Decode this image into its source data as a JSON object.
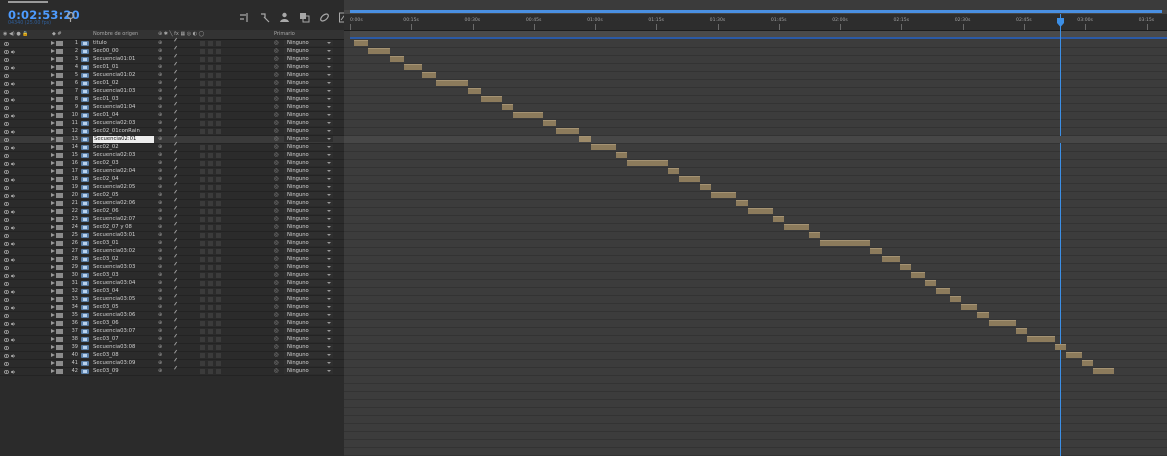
{
  "header": {
    "timecode": "0:02:53:20",
    "fps": "04340 (25.00 fps)",
    "search_placeholder": "ρ."
  },
  "columns": {
    "av": "◉ ◀) ● 🔒",
    "label": "◆ #",
    "source_name": "Nombre de origen",
    "switches": "⊕ ✱ ╲ fx ▦ ◎ ◐ ◯",
    "parent": "Primario"
  },
  "parent_default": "Ninguno",
  "layers": [
    {
      "num": "1",
      "name": "titulo",
      "audio": false
    },
    {
      "num": "2",
      "name": "Sec00_00",
      "audio": true
    },
    {
      "num": "3",
      "name": "Secuencia01:01",
      "audio": false
    },
    {
      "num": "4",
      "name": "Sec01_01",
      "audio": true
    },
    {
      "num": "5",
      "name": "Secuencia01:02",
      "audio": false
    },
    {
      "num": "6",
      "name": "Sec01_02",
      "audio": true
    },
    {
      "num": "7",
      "name": "Secuencia01:03",
      "audio": false
    },
    {
      "num": "8",
      "name": "Sec01_03",
      "audio": true
    },
    {
      "num": "9",
      "name": "Secuencia01:04",
      "audio": false
    },
    {
      "num": "10",
      "name": "Sec01_04",
      "audio": true
    },
    {
      "num": "11",
      "name": "Secuencia02:03",
      "audio": false
    },
    {
      "num": "12",
      "name": "Sec02_01conRain",
      "audio": true
    },
    {
      "num": "13",
      "name": "Secuencia02:01",
      "audio": false,
      "selected": true
    },
    {
      "num": "14",
      "name": "Sec02_02",
      "audio": true
    },
    {
      "num": "15",
      "name": "Secuencia02:03",
      "audio": false
    },
    {
      "num": "16",
      "name": "Sec02_03",
      "audio": true
    },
    {
      "num": "17",
      "name": "Secuencia02:04",
      "audio": false
    },
    {
      "num": "18",
      "name": "Sec02_04",
      "audio": true
    },
    {
      "num": "19",
      "name": "Secuencia02:05",
      "audio": false
    },
    {
      "num": "20",
      "name": "Sec02_05",
      "audio": true
    },
    {
      "num": "21",
      "name": "Secuencia02:06",
      "audio": false
    },
    {
      "num": "22",
      "name": "Sec02_06",
      "audio": true
    },
    {
      "num": "23",
      "name": "Secuencia02:07",
      "audio": false
    },
    {
      "num": "24",
      "name": "Sec02_07 y 08",
      "audio": true
    },
    {
      "num": "25",
      "name": "Secuencia03:01",
      "audio": false
    },
    {
      "num": "26",
      "name": "Sec03_01",
      "audio": true
    },
    {
      "num": "27",
      "name": "Secuencia03:02",
      "audio": false
    },
    {
      "num": "28",
      "name": "Sec03_02",
      "audio": true
    },
    {
      "num": "29",
      "name": "Secuencia03:03",
      "audio": false
    },
    {
      "num": "30",
      "name": "Sec03_03",
      "audio": true
    },
    {
      "num": "31",
      "name": "Secuencia03:04",
      "audio": false
    },
    {
      "num": "32",
      "name": "Sec03_04",
      "audio": true
    },
    {
      "num": "33",
      "name": "Secuencia03:05",
      "audio": false
    },
    {
      "num": "34",
      "name": "Sec03_05",
      "audio": true
    },
    {
      "num": "35",
      "name": "Secuencia03:06",
      "audio": false
    },
    {
      "num": "36",
      "name": "Sec03_06",
      "audio": true
    },
    {
      "num": "37",
      "name": "Secuencia03:07",
      "audio": false
    },
    {
      "num": "38",
      "name": "Sec03_07",
      "audio": true
    },
    {
      "num": "39",
      "name": "Secuencia03:08",
      "audio": false
    },
    {
      "num": "40",
      "name": "Sec03_08",
      "audio": true
    },
    {
      "num": "41",
      "name": "Secuencia03:09",
      "audio": false
    },
    {
      "num": "42",
      "name": "Sec03_09",
      "audio": true
    }
  ],
  "ruler": {
    "ticks": [
      "0:00s",
      "00:15s",
      "00:30s",
      "00:45s",
      "01:00s",
      "01:15s",
      "01:30s",
      "01:45s",
      "02:00s",
      "02:15s",
      "02:30s",
      "02:45s",
      "03:00s",
      "03:15s"
    ],
    "seconds_per_tick": 15,
    "visible_seconds": 200
  },
  "playhead_seconds": 173.8,
  "colors": {
    "timecode": "#4d9bff",
    "bar": "#8c7b5c",
    "playhead": "#3c8fe6",
    "workarea_bar": "#2b5aa6"
  }
}
